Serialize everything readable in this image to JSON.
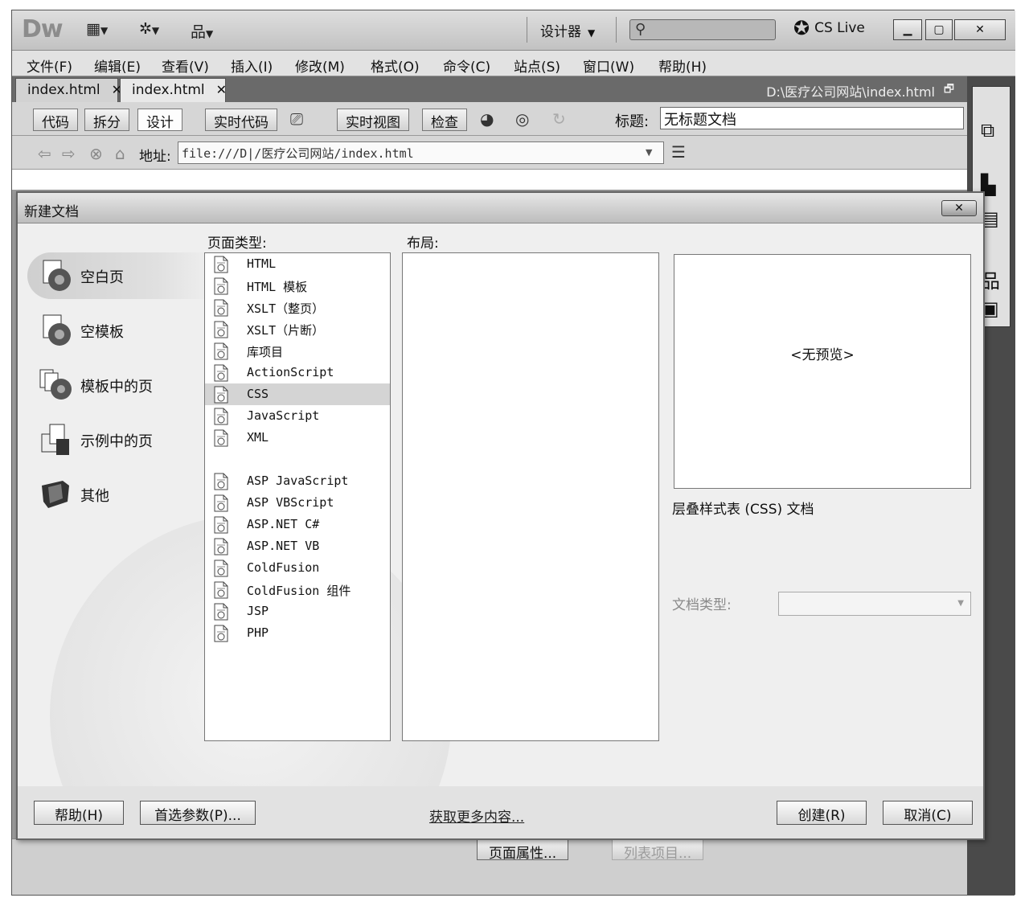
{
  "app": {
    "logo": "Dw",
    "view_mode": "设计器",
    "cs_live": "CS Live",
    "search_placeholder": ""
  },
  "menu": [
    "文件(F)",
    "编辑(E)",
    "查看(V)",
    "插入(I)",
    "修改(M)",
    "格式(O)",
    "命令(C)",
    "站点(S)",
    "窗口(W)",
    "帮助(H)"
  ],
  "tabs": [
    {
      "label": "index.html"
    },
    {
      "label": "index.html"
    }
  ],
  "file_path": "D:\\医疗公司网站\\index.html",
  "doc_toolbar": {
    "code": "代码",
    "split": "拆分",
    "design": "设计",
    "live_code": "实时代码",
    "live_view": "实时视图",
    "inspect": "检查",
    "title_label": "标题:",
    "title_value": "无标题文档"
  },
  "address": {
    "label": "地址:",
    "value": "file:///D|/医疗公司网站/index.html"
  },
  "properties": {
    "page_props": "页面属性...",
    "list_item": "列表项目..."
  },
  "dialog": {
    "title": "新建文档",
    "categories": [
      {
        "label": "空白页",
        "icon": "blank-page-icon",
        "selected": true
      },
      {
        "label": "空模板",
        "icon": "blank-template-icon",
        "selected": false
      },
      {
        "label": "模板中的页",
        "icon": "page-from-template-icon",
        "selected": false
      },
      {
        "label": "示例中的页",
        "icon": "page-from-sample-icon",
        "selected": false
      },
      {
        "label": "其他",
        "icon": "other-icon",
        "selected": false
      }
    ],
    "page_type_label": "页面类型:",
    "layout_label": "布局:",
    "page_types_group1": [
      "HTML",
      "HTML 模板",
      "XSLT（整页）",
      "XSLT（片断）",
      "库项目",
      "ActionScript",
      "CSS",
      "JavaScript",
      "XML"
    ],
    "page_types_group2": [
      "ASP JavaScript",
      "ASP VBScript",
      "ASP.NET C#",
      "ASP.NET VB",
      "ColdFusion",
      "ColdFusion 组件",
      "JSP",
      "PHP"
    ],
    "selected_page_type": "CSS",
    "preview_text": "<无预览>",
    "description": "层叠样式表 (CSS) 文档",
    "doctype_label": "文档类型:",
    "doctype_value": "",
    "help_button": "帮助(H)",
    "prefs_button": "首选参数(P)...",
    "more_link": "获取更多内容...",
    "create_button": "创建(R)",
    "cancel_button": "取消(C)"
  }
}
